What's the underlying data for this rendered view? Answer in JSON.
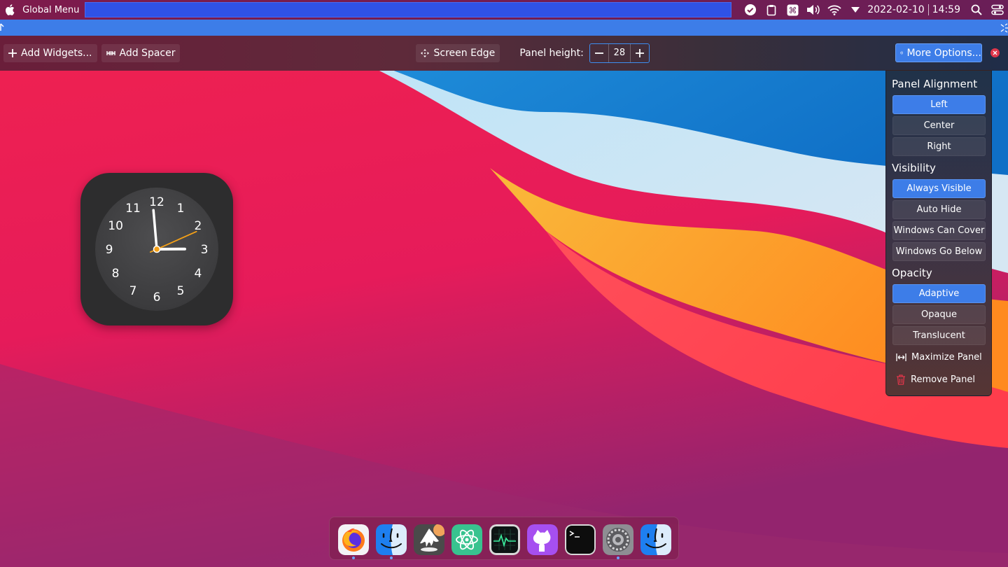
{
  "topbar": {
    "global_menu": "Global Menu",
    "date": "2022-02-10",
    "time": "14:59",
    "icons": [
      "apple-icon",
      "check-circle-icon",
      "clipboard-icon",
      "command-key-icon",
      "volume-icon",
      "wifi-icon",
      "dropdown-arrow-icon",
      "search-icon",
      "control-center-icon"
    ]
  },
  "toolbar": {
    "add_widgets": "Add Widgets...",
    "add_spacer": "Add Spacer",
    "screen_edge": "Screen Edge",
    "panel_height_label": "Panel height:",
    "panel_height_value": "28",
    "more_options": "More Options..."
  },
  "popup": {
    "alignment_title": "Panel Alignment",
    "alignment": [
      "Left",
      "Center",
      "Right"
    ],
    "alignment_selected": "Left",
    "visibility_title": "Visibility",
    "visibility": [
      "Always Visible",
      "Auto Hide",
      "Windows Can Cover",
      "Windows Go Below"
    ],
    "visibility_selected": "Always Visible",
    "opacity_title": "Opacity",
    "opacity": [
      "Adaptive",
      "Opaque",
      "Translucent"
    ],
    "opacity_selected": "Adaptive",
    "maximize_panel": "Maximize Panel",
    "remove_panel": "Remove Panel"
  },
  "clock": {
    "numbers": [
      "12",
      "1",
      "2",
      "3",
      "4",
      "5",
      "6",
      "7",
      "8",
      "9",
      "10",
      "11"
    ],
    "hour": 2,
    "minute": 59,
    "second": 11
  },
  "dock": {
    "apps": [
      {
        "name": "firefox-icon",
        "running": true
      },
      {
        "name": "finder-icon",
        "running": true
      },
      {
        "name": "inkscape-icon",
        "running": false
      },
      {
        "name": "atom-icon",
        "running": false
      },
      {
        "name": "activity-monitor-icon",
        "running": false
      },
      {
        "name": "github-desktop-icon",
        "running": false
      },
      {
        "name": "terminal-icon",
        "running": false
      },
      {
        "name": "system-preferences-icon",
        "running": true
      },
      {
        "name": "finder-icon",
        "running": false
      }
    ]
  },
  "colors": {
    "accent": "#3d7de8",
    "close": "#e0364a",
    "clock_second_hand": "#f4a017"
  }
}
